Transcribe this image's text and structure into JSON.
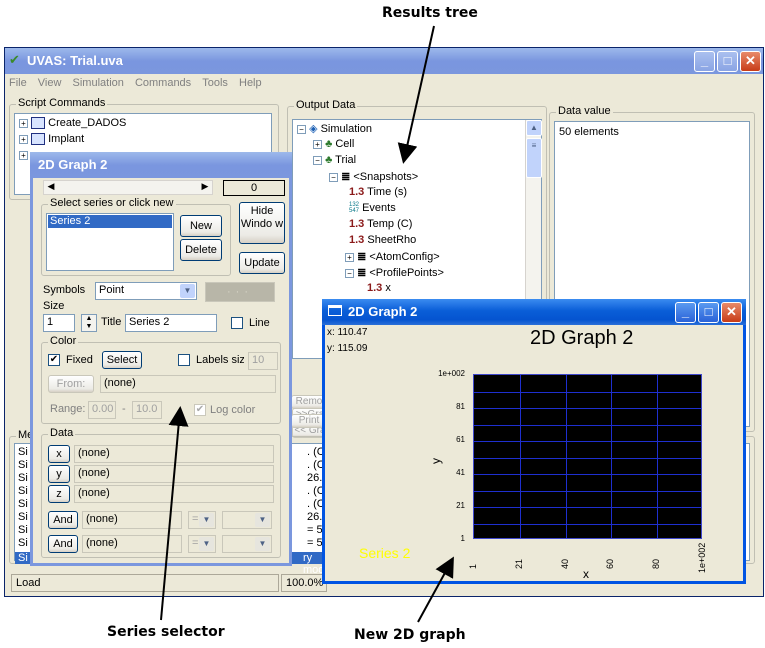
{
  "annotations": {
    "results_tree": "Results tree",
    "series_selector": "Series selector",
    "new_graph": "New 2D graph"
  },
  "app": {
    "title": "UVAS: Trial.uva",
    "menu": [
      "File",
      "View",
      "Simulation",
      "Commands",
      "Tools",
      "Help"
    ],
    "script_commands_label": "Script Commands",
    "script_commands": [
      "Create_DADOS",
      "Implant"
    ],
    "output_data_label": "Output Data",
    "data_value_label": "Data value",
    "data_value": "50 elements",
    "tree": {
      "root": "Simulation",
      "cell": "Cell",
      "trial": "Trial",
      "snapshots": "<Snapshots>",
      "time": "Time (s)",
      "events": "Events",
      "temp": "Temp (C)",
      "sheetrho": "SheetRho",
      "atomconfig": "<AtomConfig>",
      "profilepoints": "<ProfilePoints>",
      "x": "x",
      "num_icon": "1.3",
      "events_icon_top": "132",
      "events_icon_bot": "547"
    },
    "side_buttons": [
      ">>Gra",
      "<< Gra",
      "Remo",
      "Print"
    ],
    "messages_label": "Me",
    "message_prefix": "Si",
    "message_rows": [
      ". (C) = ",
      ". (C) = ",
      "26.85,",
      ". (C) = ",
      ". (C) = ",
      "26.85,",
      "= 500,",
      "= 500,"
    ],
    "message_selected": "ry mod",
    "status_left": "Load",
    "status_zoom": "100.0%"
  },
  "dialog": {
    "title": "2D Graph 2",
    "page_index": "0",
    "select_group_label": "Select series or click new",
    "series": [
      "Series 2"
    ],
    "new_label": "New",
    "delete_label": "Delete",
    "hide_label": "Hide Windo w",
    "update_label": "Update",
    "symbols_label": "Symbols",
    "symbols_value": "Point",
    "size_label": "Size",
    "size_value": "1",
    "title_label": "Title",
    "title_value": "Series 2",
    "line_label": "Line",
    "color_group_label": "Color",
    "fixed_label": "Fixed",
    "select_label": "Select",
    "labels_size_label": "Labels size",
    "labels_size_value": "10",
    "from_label": "From:",
    "from_value": "(none)",
    "range_label": "Range:",
    "range_min": "0.00",
    "range_sep": "-",
    "range_max": "10.0",
    "log_color_label": "Log color",
    "data_group_label": "Data",
    "x_label": "x",
    "y_label": "y",
    "z_label": "z",
    "x_value": "(none)",
    "y_value": "(none)",
    "z_value": "(none)",
    "and_label": "And",
    "and1_value": "(none)",
    "and2_value": "(none)",
    "op_value": "="
  },
  "graph": {
    "window_title": "2D Graph 2",
    "heading": "2D Graph 2",
    "cursor_x": "x: 110.47",
    "cursor_y": "y: 115.09",
    "series_label": "Series 2",
    "series_color": "#ffff00",
    "plot_bg": "#000000",
    "grid_color": "#1e2fd0"
  },
  "chart_data": {
    "type": "scatter",
    "title": "2D Graph 2",
    "xlabel": "x",
    "ylabel": "y",
    "xlim": [
      1,
      100
    ],
    "ylim": [
      1,
      100
    ],
    "x_ticks": [
      "1",
      "21",
      "40",
      "60",
      "80",
      "1e+002"
    ],
    "y_ticks": [
      "1e+002",
      "81",
      "61",
      "41",
      "21",
      "1"
    ],
    "series": [
      {
        "name": "Series 2",
        "values": []
      }
    ],
    "grid": true
  }
}
